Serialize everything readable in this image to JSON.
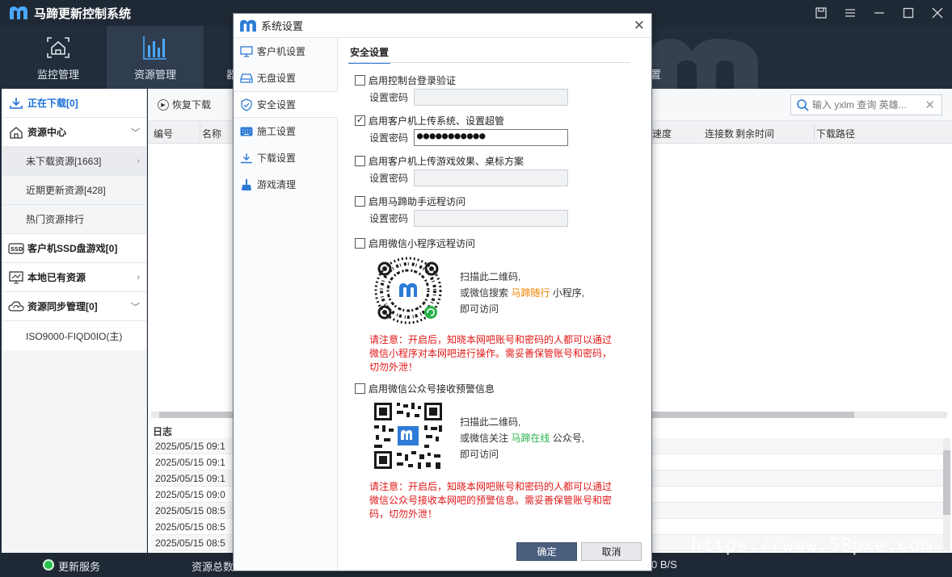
{
  "app": {
    "title": "马蹄更新控制系统"
  },
  "nav": {
    "tabs": [
      {
        "label": "监控管理"
      },
      {
        "label": "资源管理"
      }
    ],
    "partial_left": "器",
    "partial_right": "置"
  },
  "sidebar": {
    "downloading": "正在下载[0]",
    "resource_center": "资源中心",
    "not_downloaded": "未下载资源[1663]",
    "recent_updates": "近期更新资源[428]",
    "hot_ranking": "热门资源排行",
    "ssd_games": "客户机SSD盘游戏[0]",
    "local_resources": "本地已有资源",
    "sync_management": "资源同步管理[0]",
    "sync_server": "ISO9000-FIQD0IO(主)"
  },
  "toolbar": {
    "resume": "恢复下载",
    "search_placeholder": "输入 yxlm 查询 英雄..."
  },
  "table": {
    "headers": [
      "编号",
      "名称",
      "速度",
      "连接数",
      "剩余时间",
      "下载路径"
    ]
  },
  "log": {
    "title": "日志",
    "rows": [
      "2025/05/15 09:1",
      "2025/05/15 09:1",
      "2025/05/15 09:1",
      "2025/05/15 09:0",
      "2025/05/15 08:5",
      "2025/05/15 08:5",
      "2025/05/15 08:5"
    ]
  },
  "status": {
    "service": "更新服务",
    "total": "资源总数",
    "speed": "0 B/S",
    "service_color": "#27c24c"
  },
  "watermark": "https://www.58pxe.com",
  "dialog": {
    "title": "系统设置",
    "menu": [
      {
        "label": "客户机设置",
        "icon": "monitor-icon"
      },
      {
        "label": "无盘设置",
        "icon": "disk-icon"
      },
      {
        "label": "安全设置",
        "icon": "shield-icon"
      },
      {
        "label": "施工设置",
        "icon": "keyboard-icon"
      },
      {
        "label": "下载设置",
        "icon": "download-icon"
      },
      {
        "label": "游戏清理",
        "icon": "broom-icon"
      }
    ],
    "section_title": "安全设置",
    "password_label": "设置密码",
    "options": {
      "console_login": "启用控制台登录验证",
      "upload_system": "启用客户机上传系统、设置超管",
      "upload_system_password": "●●●●●●●●●●●",
      "upload_game": "启用客户机上传游戏效果、桌标方案",
      "remote_access": "启用马蹄助手远程访问",
      "wechat_mini": "启用微信小程序远程访问",
      "wechat_official": "启用微信公众号接收预警信息"
    },
    "mini_qr": {
      "line1": "扫描此二维码,",
      "line2_prefix": "或微信搜索",
      "line2_highlight": "马蹄随行",
      "line2_suffix": "小程序,",
      "line3": "即可访问",
      "warning": "请注意：开启后，知晓本网吧账号和密码的人都可以通过微信小程序对本网吧进行操作。需妥善保管账号和密码，切勿外泄！"
    },
    "official_qr": {
      "line1": "扫描此二维码,",
      "line2_prefix": "或微信关注",
      "line2_highlight": "马蹄在线",
      "line2_suffix": "公众号,",
      "line3": "即可访问",
      "warning": "请注意：开启后，知晓本网吧账号和密码的人都可以通过微信公众号接收本网吧的预警信息。需妥善保管账号和密码，切勿外泄！"
    },
    "ok": "确定",
    "cancel": "取消"
  },
  "colors": {
    "accent": "#2d7bd6",
    "warning": "#e01818",
    "highlight_orange": "#f08200",
    "highlight_green": "#27b24a"
  }
}
